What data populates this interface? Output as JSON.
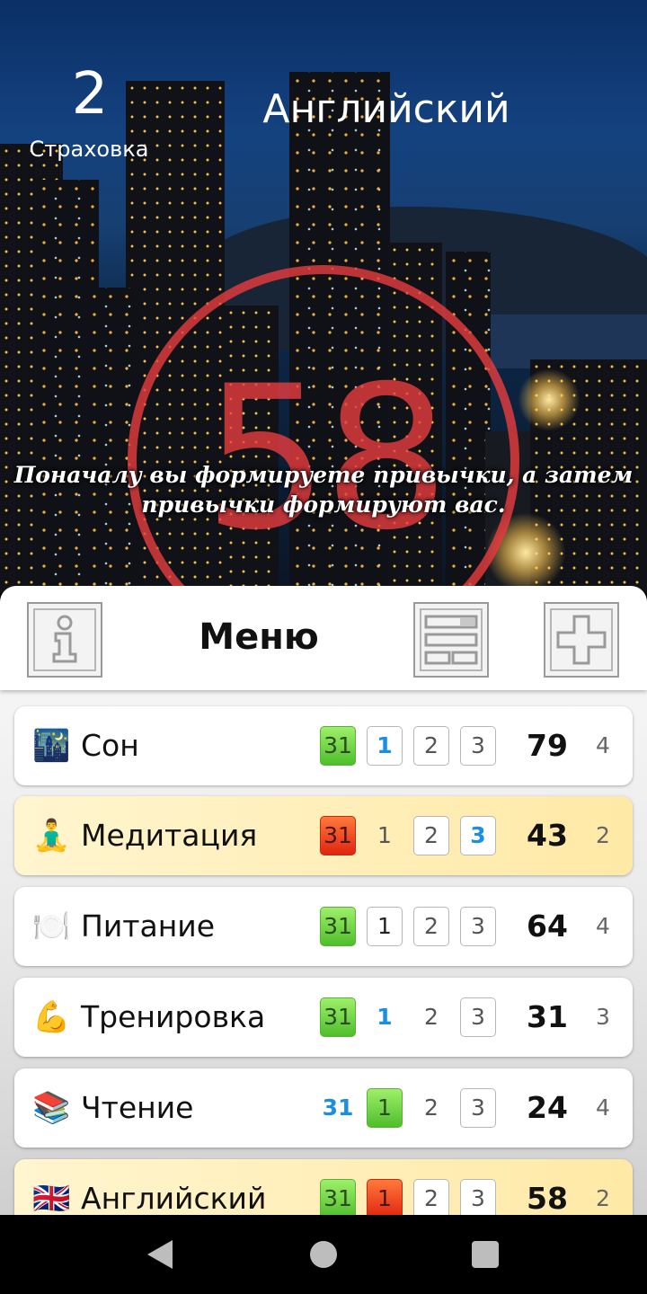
{
  "header": {
    "counter_value": "2",
    "counter_label": "Страховка",
    "goal_title": "Английский",
    "ring_value": "58",
    "ring_color": "#e43c3e",
    "quote": "Поначалу вы формируете привычки, а затем привычки формируют вас."
  },
  "menu": {
    "title": "Меню",
    "info_icon": "info-icon",
    "list_icon": "list-view-icon",
    "add_icon": "plus-icon"
  },
  "habits": [
    {
      "emoji": "🌃",
      "name": "Сон",
      "boxes": [
        {
          "v": "31",
          "s": "green"
        },
        {
          "v": "1",
          "s": "blue"
        },
        {
          "v": "2",
          "s": "plain-grey"
        },
        {
          "v": "3",
          "s": "plain-grey"
        }
      ],
      "score": "79",
      "small": "4",
      "highlighted": false
    },
    {
      "emoji": "🧘‍♂️",
      "name": "Медитация",
      "boxes": [
        {
          "v": "31",
          "s": "red"
        },
        {
          "v": "1",
          "s": "none"
        },
        {
          "v": "2",
          "s": "plain-grey"
        },
        {
          "v": "3",
          "s": "blue"
        }
      ],
      "score": "43",
      "small": "2",
      "highlighted": true
    },
    {
      "emoji": "🍽️",
      "name": "Питание",
      "boxes": [
        {
          "v": "31",
          "s": "green"
        },
        {
          "v": "1",
          "s": "plain"
        },
        {
          "v": "2",
          "s": "plain-grey"
        },
        {
          "v": "3",
          "s": "plain-grey"
        }
      ],
      "score": "64",
      "small": "4",
      "highlighted": false
    },
    {
      "emoji": "💪",
      "name": "Тренировка",
      "boxes": [
        {
          "v": "31",
          "s": "green"
        },
        {
          "v": "1",
          "s": "blue-none"
        },
        {
          "v": "2",
          "s": "none"
        },
        {
          "v": "3",
          "s": "plain-grey"
        }
      ],
      "score": "31",
      "small": "3",
      "highlighted": false
    },
    {
      "emoji": "📚",
      "name": "Чтение",
      "boxes": [
        {
          "v": "31",
          "s": "blue-none"
        },
        {
          "v": "1",
          "s": "green"
        },
        {
          "v": "2",
          "s": "none"
        },
        {
          "v": "3",
          "s": "plain-grey"
        }
      ],
      "score": "24",
      "small": "4",
      "highlighted": false
    },
    {
      "emoji": "🇬🇧",
      "name": "Английский",
      "boxes": [
        {
          "v": "31",
          "s": "green"
        },
        {
          "v": "1",
          "s": "red"
        },
        {
          "v": "2",
          "s": "plain-grey"
        },
        {
          "v": "3",
          "s": "plain-grey"
        }
      ],
      "score": "58",
      "small": "2",
      "highlighted": true
    }
  ],
  "nav": {
    "back": "back-icon",
    "home": "home-icon",
    "recent": "recents-icon"
  }
}
